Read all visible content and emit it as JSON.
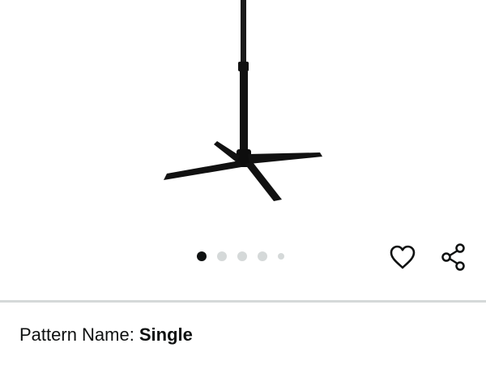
{
  "product": {
    "image_alt": "Black tripod stand with cross base"
  },
  "carousel": {
    "total_images": 5,
    "active_index": 0
  },
  "actions": {
    "favorite_icon": "heart-outline-icon",
    "share_icon": "share-icon"
  },
  "variation": {
    "label": "Pattern Name:",
    "value": "Single"
  },
  "colors": {
    "text": "#0f1111",
    "dot_active": "#0f1111",
    "dot_inactive": "#d5d9d9",
    "divider": "#d5d9d9",
    "product": "#111111"
  }
}
